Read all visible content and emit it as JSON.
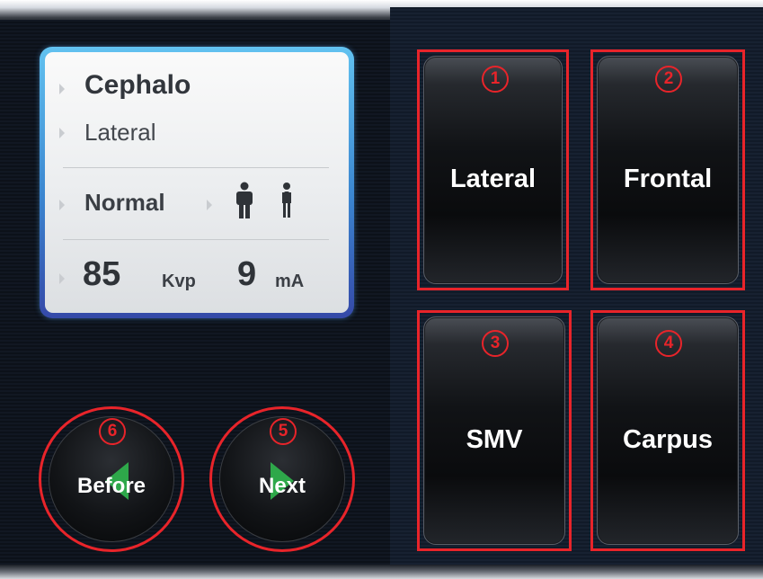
{
  "info": {
    "title": "Cephalo",
    "projection": "Lateral",
    "mode": "Normal",
    "kvp_value": "85",
    "kvp_unit": "Kvp",
    "ma_value": "9",
    "ma_unit": "mA",
    "patient_icons": [
      "adult-person-icon",
      "child-person-icon"
    ]
  },
  "options": [
    {
      "badge": "1",
      "label": "Lateral"
    },
    {
      "badge": "2",
      "label": "Frontal"
    },
    {
      "badge": "3",
      "label": "SMV"
    },
    {
      "badge": "4",
      "label": "Carpus"
    }
  ],
  "nav": {
    "before": {
      "badge": "6",
      "label": "Before"
    },
    "next": {
      "badge": "5",
      "label": "Next"
    }
  },
  "colors": {
    "annotation_red": "#e8242a",
    "arrow_green": "#2ea84a",
    "panel_border_blue": "#3b86d0",
    "button_text": "#ffffff",
    "info_text": "#3b3f45"
  }
}
